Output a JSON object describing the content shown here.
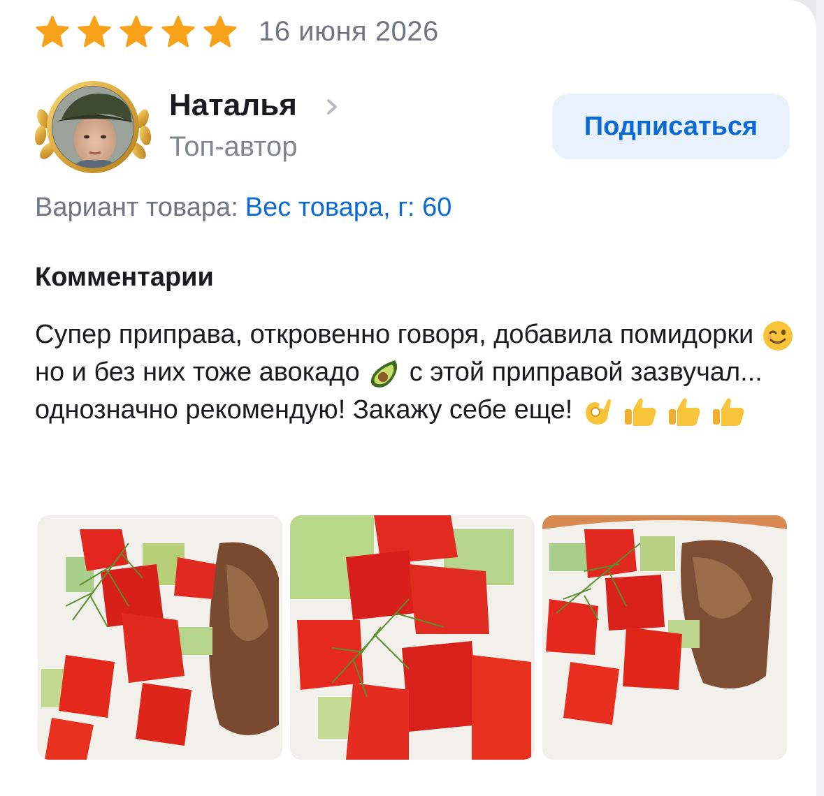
{
  "review": {
    "rating": 5,
    "rating_max": 5,
    "date": "16 июня 2026"
  },
  "author": {
    "name": "Наталья",
    "status": "Топ-автор",
    "subscribe_label": "Подписаться"
  },
  "variant": {
    "label": "Вариант товара:",
    "value": "Вес товара, г: 60"
  },
  "comments": {
    "title": "Комментарии",
    "parts": [
      "Супер приправа, откровенно говоря, добавила помидорки",
      "но и без них тоже авокадо",
      "с этой приправой зазвучал... однозначно рекомендую! Закажу себе еще!"
    ],
    "emojis": [
      "winking-face-emoji",
      "avocado-emoji",
      "ok-hand-emoji",
      "thumbs-up-emoji",
      "thumbs-up-emoji",
      "thumbs-up-emoji"
    ]
  },
  "photos": [
    "salad-photo-1",
    "salad-photo-2",
    "salad-photo-3"
  ],
  "colors": {
    "star": "#f8a21a",
    "accent_blue": "#0a6ad8",
    "button_bg": "#e9f2fc",
    "muted_text": "#70757f"
  }
}
